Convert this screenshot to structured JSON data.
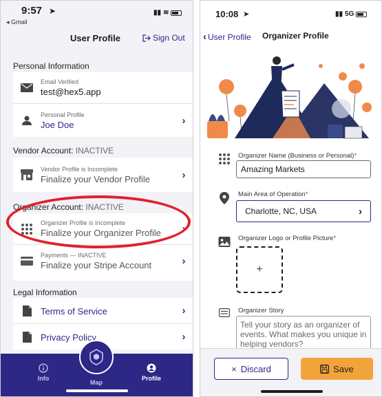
{
  "left_screen": {
    "status": {
      "time": "9:57",
      "back_app": "◂ Gmail"
    },
    "nav": {
      "title": "User Profile",
      "sign_out": "Sign Out"
    },
    "personal": {
      "header": "Personal Information",
      "email_small": "Email Verified",
      "email_value": "test@hex5.app",
      "profile_small": "Personal Profile",
      "profile_value": "Joe Doe"
    },
    "vendor": {
      "header_label": "Vendor Account:",
      "header_status": "INACTIVE",
      "small": "Vendor Profile is Incomplete",
      "value": "Finalize your Vendor Profile"
    },
    "organizer": {
      "header_label": "Organizer Account:",
      "header_status": "INACTIVE",
      "small": "Organizer Profile is Incomplete",
      "value": "Finalize your Organizer Profile"
    },
    "payments": {
      "small": "Payments — INACTIVE",
      "value": "Finalize your Stripe Account"
    },
    "legal": {
      "header": "Legal Information",
      "terms": "Terms of Service",
      "privacy": "Privacy Policy"
    },
    "tabs": {
      "info": "Info",
      "map": "Map",
      "profile": "Profile"
    }
  },
  "right_screen": {
    "status": {
      "time": "10:08",
      "network": "5G"
    },
    "nav": {
      "back": "User Profile",
      "title": "Organizer Profile"
    },
    "form": {
      "name_label": "Organizer Name (Business or Personal)",
      "name_value": "Amazing Markets",
      "area_label": "Main Area of Operation",
      "area_value": "Charlotte, NC, USA",
      "logo_label": "Organizer Logo or Profile Picture",
      "logo_plus": "+",
      "story_label": "Organizer Story",
      "story_placeholder": "Tell your story as an organizer of events. What makes you unique in helping vendors?",
      "required_mark": "*"
    },
    "buttons": {
      "discard": "Discard",
      "discard_icon": "×",
      "save": "Save"
    }
  },
  "colors": {
    "brand": "#2d2785",
    "accent": "#f2a43a",
    "annotation": "#e0212b"
  }
}
